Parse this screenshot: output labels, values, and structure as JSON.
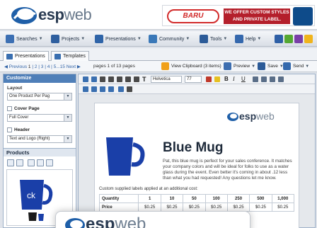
{
  "header": {
    "logo_main": "esp",
    "logo_suffix": "web",
    "ad_brand": "BARU",
    "ad_text_1": "WE OFFER CUSTOM STYLES",
    "ad_text_2": "AND PRIVATE LABEL."
  },
  "menubar": {
    "items": [
      {
        "label": "Searches",
        "icon": "search-icon"
      },
      {
        "label": "Projects",
        "icon": "folder-icon"
      },
      {
        "label": "Presentations",
        "icon": "presentation-icon"
      },
      {
        "label": "Community",
        "icon": "people-icon"
      },
      {
        "label": "Tools",
        "icon": "wrench-icon"
      },
      {
        "label": "Help",
        "icon": "help-icon"
      }
    ]
  },
  "tabs": [
    {
      "label": "Presentations",
      "active": true
    },
    {
      "label": "Templates",
      "active": false
    }
  ],
  "pager": {
    "previous": "◀ Previous",
    "pages": [
      "1",
      "2",
      "3",
      "4",
      "5...15"
    ],
    "next": "Next ▶",
    "page_of": "pages 1 of 13 pages",
    "view_clipboard": "View Clipboard (3 items)",
    "preview": "Preview",
    "save": "Save",
    "send": "Send"
  },
  "customize": {
    "title": "Customize",
    "layout_label": "Layout",
    "layout_value": "One Product Per Pag",
    "cover_label": "Cover Page",
    "cover_value": "Full Cover",
    "header_label": "Header",
    "header_value": "Text and Logo (Right)"
  },
  "products": {
    "title": "Products",
    "thumb_text": "ck"
  },
  "editor": {
    "font": "Helvetica",
    "size": "77",
    "bold": "B",
    "italic": "I",
    "underline": "U",
    "text_tool": "T"
  },
  "page": {
    "logo_main": "esp",
    "logo_suffix": "web",
    "title": "Blue Mug",
    "description": "Pat, this blue mug is perfect for your sales conference. It matches your company colors and will be ideal for folks to use as a water glass during the event. Even better it's coming in about .12 less than what you had requested! Any questions let me know.",
    "note": "Custom supplied labels applied at an additional cost:",
    "table_header": [
      "Quantity",
      "1",
      "10",
      "50",
      "100",
      "250",
      "500",
      "1,000"
    ],
    "table_row": [
      "Price",
      "$0.25",
      "$0.25",
      "$0.25",
      "$0.25",
      "$0.25",
      "$0.25",
      "$0.25"
    ]
  },
  "popup": {
    "logo_main": "esp",
    "logo_suffix": "web"
  },
  "colors": {
    "brand_blue": "#1f5fa8",
    "panel_header": "#4f7fb8"
  }
}
